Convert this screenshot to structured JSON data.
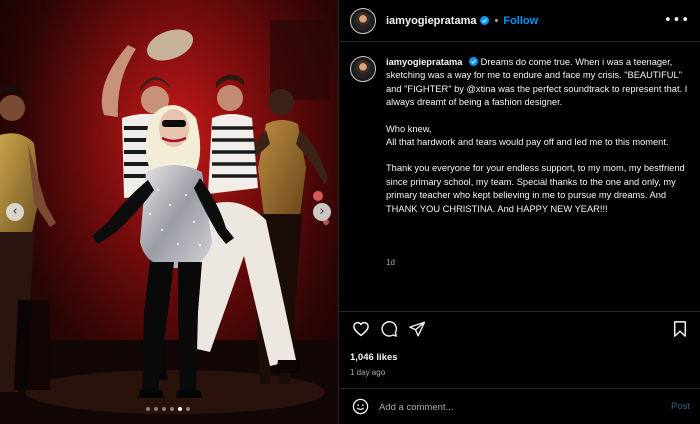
{
  "post": {
    "username": "iamyogiepratama",
    "follow_label": "Follow",
    "separator": "•",
    "more_label": "•••",
    "caption": {
      "paragraph1": "Dreams do come true. When i was a teenager, sketching was a way for me to endure and face my crisis. \"BEAUTIFUL\" and \"FIGHTER\" by @xtina was the perfect soundtrack to represent that. I always dreamt of being a fashion designer.",
      "paragraph2a": "Who knew,",
      "paragraph2b": "All that hardwork and tears would pay off and led me to this moment.",
      "paragraph3": "Thank you everyone for your endless support, to my mom, my bestfriend since primary school, my team. Special thanks to the one and only, my primary teacher who kept believing in me to pursue my dreams. And THANK YOU CHRISTINA. And HAPPY NEW YEAR!!!"
    },
    "caption_time": "1d",
    "likes": "1,046 likes",
    "date": "1 day ago"
  },
  "carousel": {
    "prev_icon": "‹",
    "next_icon": "›",
    "slide_count": 6,
    "active_index": 4
  },
  "comment": {
    "placeholder": "Add a comment...",
    "post_label": "Post"
  },
  "icons": {
    "verified": "verified-badge-icon",
    "like": "heart-icon",
    "comment": "comment-bubble-icon",
    "share": "paper-plane-icon",
    "save": "bookmark-icon",
    "emoji": "smiley-icon"
  },
  "colors": {
    "background": "#000000",
    "link_blue": "#0095f6",
    "post_button": "#2b5e86",
    "secondary_text": "#a8a8a8",
    "divider": "#262626"
  }
}
